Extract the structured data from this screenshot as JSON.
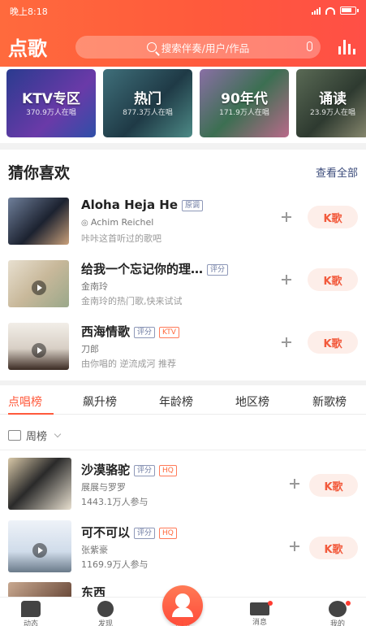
{
  "status_bar": {
    "time": "晚上8:18"
  },
  "header": {
    "title": "点歌",
    "search_placeholder": "搜索伴奏/用户/作品"
  },
  "categories": [
    {
      "name": "KTV专区",
      "sub": "370.9万人在唱"
    },
    {
      "name": "热门",
      "sub": "877.3万人在唱"
    },
    {
      "name": "90年代",
      "sub": "171.9万人在唱"
    },
    {
      "name": "诵读",
      "sub": "23.9万人在唱"
    }
  ],
  "guess": {
    "title": "猜你喜欢",
    "see_all": "查看全部",
    "k_label": "K歌",
    "items": [
      {
        "title": "Aloha Heja He",
        "tags": [
          "原调"
        ],
        "singer": "Achim Reichel",
        "desc": "咔咔这首听过的歌吧"
      },
      {
        "title": "给我一个忘记你的理…",
        "tags": [
          "评分"
        ],
        "singer": "金南玲",
        "desc": "金南玲的热门歌,快来试试"
      },
      {
        "title": "西海情歌",
        "tags": [
          "评分",
          "KTV"
        ],
        "singer": "刀郎",
        "desc": "由你唱的 逆流成河 推荐"
      }
    ]
  },
  "rank_tabs": [
    "点唱榜",
    "飙升榜",
    "年龄榜",
    "地区榜",
    "新歌榜"
  ],
  "period": "周榜",
  "ranking": {
    "k_label": "K歌",
    "items": [
      {
        "title": "沙漠骆驼",
        "tags": [
          "评分",
          "HQ"
        ],
        "singer": "展展与罗罗",
        "count": "1443.1万人参与"
      },
      {
        "title": "可不可以",
        "tags": [
          "评分",
          "HQ"
        ],
        "singer": "张紫豪",
        "count": "1169.9万人参与"
      },
      {
        "title": "东西",
        "tags": [],
        "singer": "",
        "count": ""
      }
    ]
  },
  "bottom_nav": [
    "动态",
    "发现",
    "点歌",
    "消息",
    "我的"
  ],
  "colors": {
    "accent": "#ff5a3c",
    "k_button_bg": "#fdeee9"
  }
}
